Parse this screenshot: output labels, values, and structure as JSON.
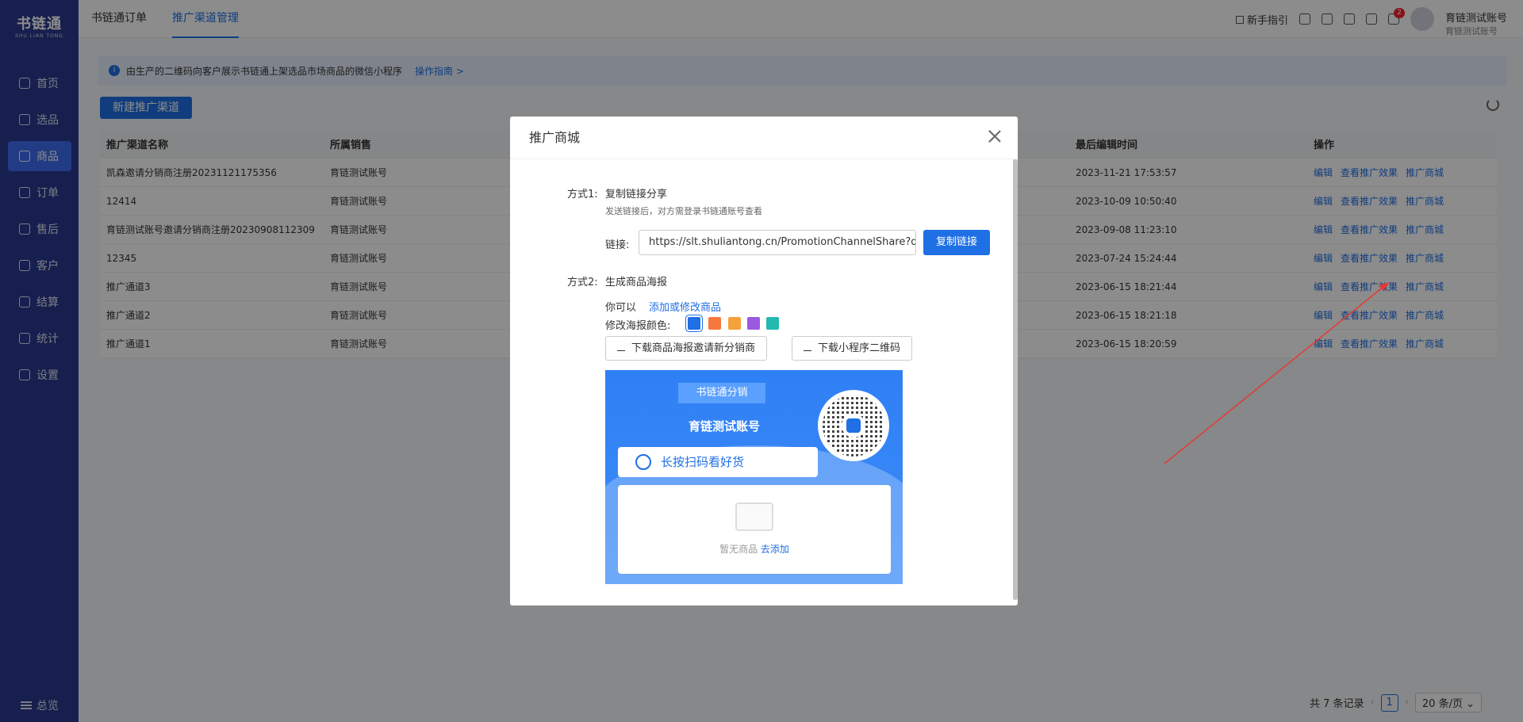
{
  "sidebar": {
    "logo": "书链通",
    "logo_sub": "SHU LIAN TONG",
    "items": [
      {
        "label": "首页"
      },
      {
        "label": "选品"
      },
      {
        "label": "商品"
      },
      {
        "label": "订单"
      },
      {
        "label": "售后"
      },
      {
        "label": "客户"
      },
      {
        "label": "结算"
      },
      {
        "label": "统计"
      },
      {
        "label": "设置"
      }
    ],
    "active_index": 2,
    "bottom_label": "总览"
  },
  "topbar": {
    "tabs": [
      {
        "label": "书链通订单"
      },
      {
        "label": "推广渠道管理"
      }
    ],
    "guide": "新手指引",
    "notification_count": "2",
    "account_name": "育链测试账号",
    "account_sub": "育链测试账号"
  },
  "notice": {
    "text": "由生产的二维码向客户展示书链通上架选品市场商品的微信小程序",
    "link": "操作指南 >"
  },
  "new_button": "新建推广渠道",
  "table": {
    "headers": [
      "推广渠道名称",
      "所属销售",
      "最后编辑时间",
      "操作"
    ],
    "ops": [
      "编辑",
      "查看推广效果",
      "推广商城"
    ],
    "rows": [
      {
        "name": "凯森邀请分销商注册20231121175356",
        "sales": "育链测试账号",
        "time": "2023-11-21 17:53:57"
      },
      {
        "name": "12414",
        "sales": "育链测试账号",
        "time": "2023-10-09 10:50:40"
      },
      {
        "name": "育链测试账号邀请分销商注册20230908112309",
        "sales": "育链测试账号",
        "time": "2023-09-08 11:23:10"
      },
      {
        "name": "12345",
        "sales": "育链测试账号",
        "time": "2023-07-24 15:24:44"
      },
      {
        "name": "推广通道3",
        "sales": "育链测试账号",
        "time": "2023-06-15 18:21:44"
      },
      {
        "name": "推广通道2",
        "sales": "育链测试账号",
        "time": "2023-06-15 18:21:18"
      },
      {
        "name": "推广通道1",
        "sales": "育链测试账号",
        "time": "2023-06-15 18:20:59"
      }
    ]
  },
  "pager": {
    "total": "共 7 条记录",
    "page": "1",
    "size": "20 条/页"
  },
  "modal": {
    "title": "推广商城",
    "way1_label": "方式1:",
    "way1_title": "复制链接分享",
    "way1_desc": "发送链接后，对方需登录书链通账号查看",
    "link_label": "链接:",
    "link_value": "https://slt.shuliantong.cn/PromotionChannelShare?q",
    "copy_button": "复制链接",
    "way2_label": "方式2:",
    "way2_title": "生成商品海报",
    "can_text": "你可以",
    "edit_link": "添加或修改商品",
    "color_label": "修改海报颜色:",
    "colors": [
      "#1f6fe5",
      "#f5793b",
      "#f5a23b",
      "#9b59e0",
      "#23b8b0"
    ],
    "download_poster": "下载商品海报邀请新分销商",
    "download_qr": "下载小程序二维码",
    "poster": {
      "ribbon": "书链通分销",
      "account": "育链测试账号",
      "scan_text": "长按扫码看好货",
      "empty_text": "暂无商品",
      "empty_link": "去添加"
    }
  }
}
